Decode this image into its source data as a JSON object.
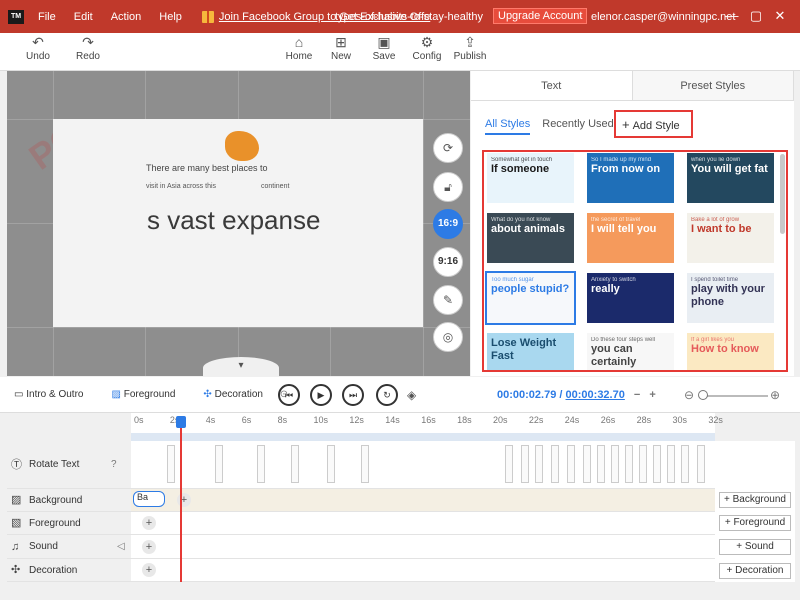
{
  "titlebar": {
    "logo": "TM",
    "menu": [
      "File",
      "Edit",
      "Action",
      "Help"
    ],
    "promo": "Join Facebook Group to Get Exclusive Offe",
    "doc_title": "types-of-habits-to-stay-healthy",
    "upgrade": "Upgrade Account",
    "email": "elenor.casper@winningpc.net",
    "win_min": "—",
    "win_max": "▢",
    "win_close": "✕"
  },
  "toolbar": {
    "undo": "Undo",
    "redo": "Redo",
    "home": "Home",
    "new": "New",
    "save": "Save",
    "config": "Config",
    "publish": "Publish"
  },
  "canvas": {
    "line1": "There are many best places to",
    "line2a": "visit in Asia across this",
    "line2b": "continent",
    "big": "s vast expanse",
    "watermark": "PC"
  },
  "side_buttons": {
    "ratio_169": "16:9",
    "ratio_916": "9:16"
  },
  "right_panel": {
    "tabs": [
      "Text",
      "Preset Styles"
    ],
    "subtabs": [
      "All Styles",
      "Recently Used"
    ],
    "add_style": "Add Style",
    "thumbs": [
      {
        "text": "If someone",
        "sub": "Somewhat get in touch",
        "bg": "#e8f4fb",
        "fg": "#1a1a1a"
      },
      {
        "text": "From now on",
        "sub": "So I made up my mind",
        "bg": "#1f6fb8",
        "fg": "#ffffff"
      },
      {
        "text": "You will get fat",
        "sub": "when you lie down",
        "bg": "#23485f",
        "fg": "#ffffff"
      },
      {
        "text": "about animals",
        "sub": "What do you not know",
        "bg": "#3a4a55",
        "fg": "#ffffff"
      },
      {
        "text": "I will tell you",
        "sub": "the secret of travel",
        "bg": "#f59a5c",
        "fg": "#ffffff"
      },
      {
        "text": "I want to be",
        "sub": "Bake a lot of grow",
        "bg": "#f3f1ea",
        "fg": "#c0392b"
      },
      {
        "text": "people stupid?",
        "sub": "Too much sugar",
        "bg": "#f6f8fb",
        "fg": "#2d7be5"
      },
      {
        "text": "really",
        "sub": "Anxiety to switch",
        "bg": "#1b2a6b",
        "fg": "#ffffff"
      },
      {
        "text": "play with your phone",
        "sub": "I spend toilet time",
        "bg": "#e9eef3",
        "fg": "#335"
      },
      {
        "text": "Lose Weight Fast",
        "sub": "",
        "bg": "#a9d8ef",
        "fg": "#1a4d6e"
      },
      {
        "text": "you can certainly",
        "sub": "Do these four steps well",
        "bg": "#f7f7f7",
        "fg": "#444"
      },
      {
        "text": "How to know",
        "sub": "If a girl likes you",
        "bg": "#fbe9c2",
        "fg": "#e55a5a"
      }
    ]
  },
  "timeline": {
    "intro_outro": "Intro & Outro",
    "foreground": "Foreground",
    "decoration": "Decoration",
    "current_time": "00:00:02.79",
    "separator": "/",
    "total_time": "00:00:32.70",
    "ticks": [
      "0s",
      "2s",
      "4s",
      "6s",
      "8s",
      "10s",
      "12s",
      "14s",
      "16s",
      "18s",
      "20s",
      "22s",
      "24s",
      "26s",
      "28s",
      "30s",
      "32s"
    ],
    "playhead_seconds": 2.79
  },
  "tracks": {
    "rotate_text": "Rotate Text",
    "background": "Background",
    "foreground": "Foreground",
    "sound": "Sound",
    "decoration": "Decoration",
    "bg_chip": "Ba"
  },
  "add_buttons": {
    "background": "Background",
    "foreground": "Foreground",
    "sound": "Sound",
    "decoration": "Decoration"
  },
  "colors": {
    "accent": "#2d7be5",
    "titlebar": "#c0392b",
    "highlight": "#e53935"
  }
}
